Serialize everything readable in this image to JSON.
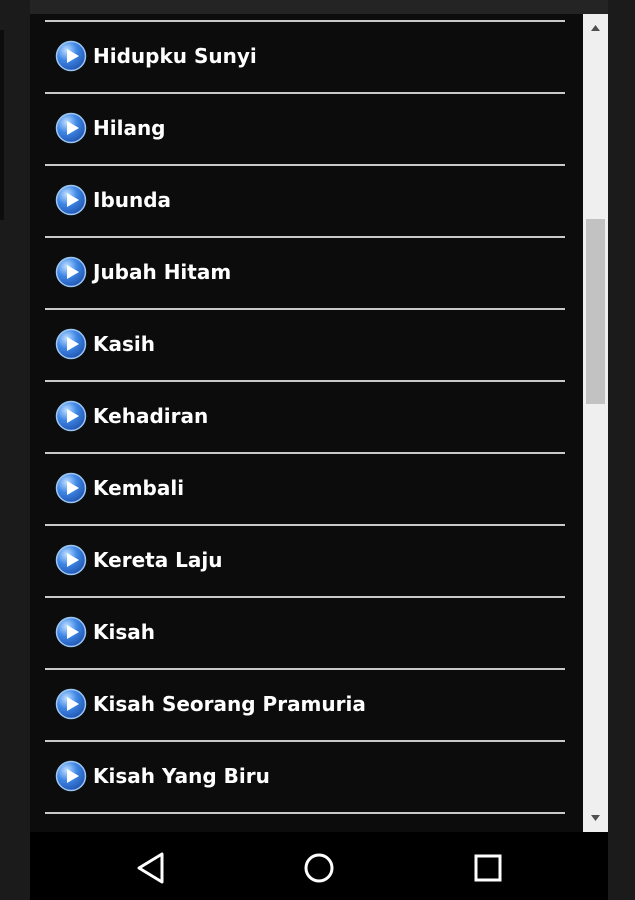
{
  "songs": [
    "Hidupku Sunyi",
    "Hilang",
    "Ibunda",
    "Jubah Hitam",
    "Kasih",
    "Kehadiran",
    "Kembali",
    "Kereta Laju",
    "Kisah",
    "Kisah Seorang Pramuria",
    "Kisah Yang Biru",
    ""
  ],
  "icons": {
    "item": "play-icon",
    "scroll_up": "scroll-up-arrow-icon",
    "scroll_down": "scroll-down-arrow-icon",
    "nav_back": "back-triangle-icon",
    "nav_home": "home-circle-icon",
    "nav_recents": "recents-square-icon"
  },
  "colors": {
    "background": "#0c0c0c",
    "text": "#ffffff",
    "divider": "#c9c9c9",
    "play_icon": "#3f86e6",
    "scrollbar_track": "#efefef",
    "scrollbar_thumb": "#c2c2c2",
    "navbar": "#000000"
  },
  "scroll": {
    "position_fraction": 0.24,
    "visible_fraction": 0.23
  }
}
